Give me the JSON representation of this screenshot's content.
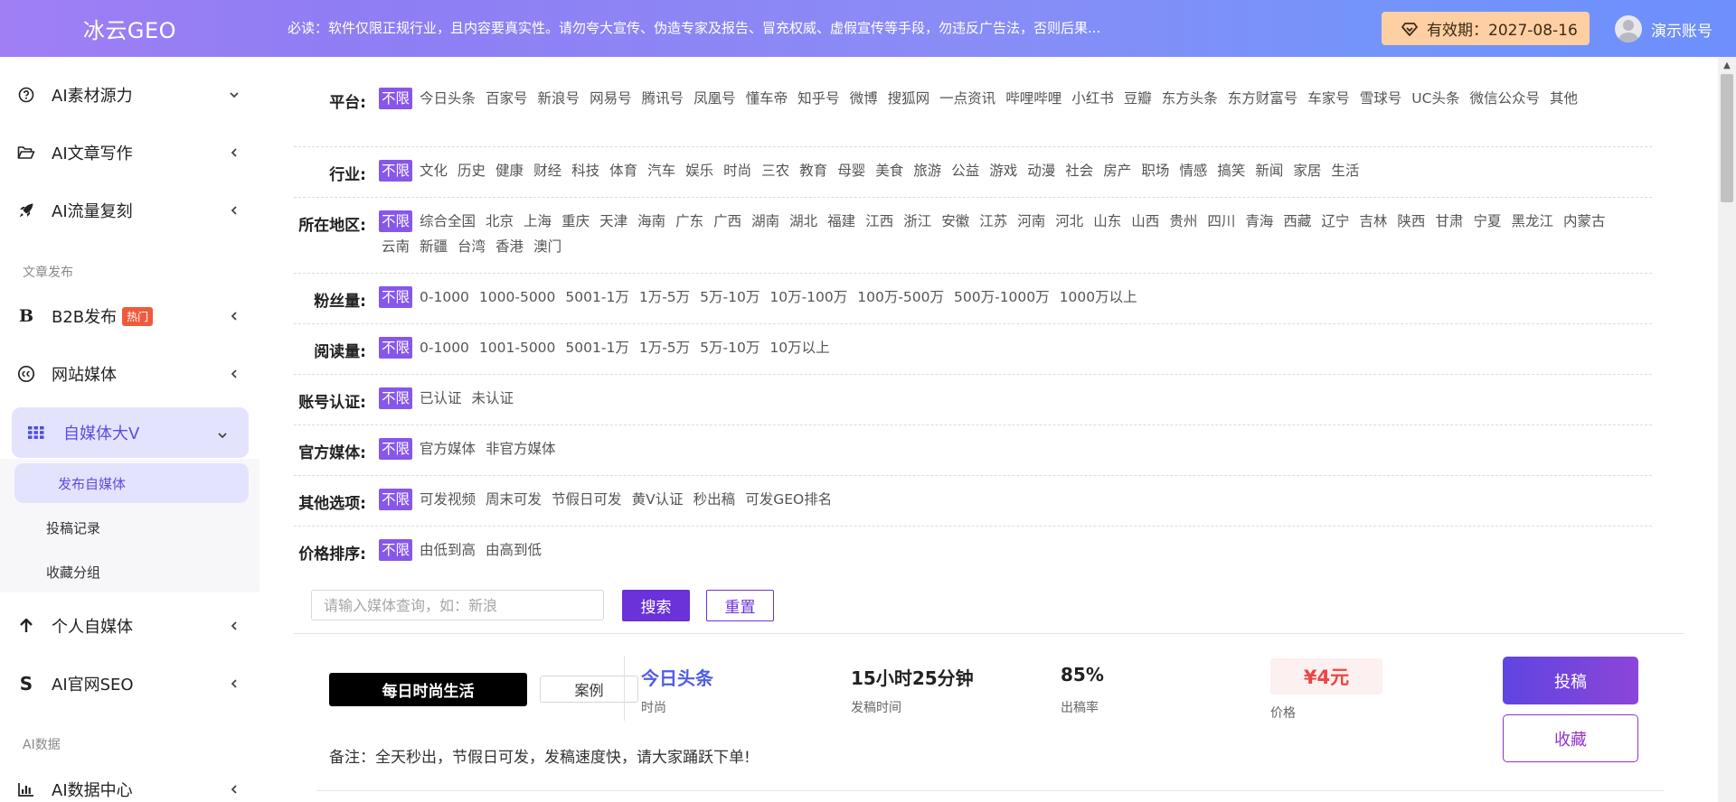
{
  "header": {
    "logo": "冰云GEO",
    "notice": "必读：软件仅限正规行业，且内容要真实性。请勿夸大宣传、伪造专家及报告、冒充权威、虚假宣传等手段，勿违反广告法，否则后果...",
    "expiry": "有效期：2027-08-16",
    "account": "演示账号"
  },
  "sidebar": {
    "items": [
      {
        "label": "AI素材源力",
        "icon": "question-circle-icon",
        "arrow": "chevron-down"
      },
      {
        "label": "AI文章写作",
        "icon": "folder-open-icon",
        "arrow": "chevron-left"
      },
      {
        "label": "AI流量复刻",
        "icon": "rocket-icon",
        "arrow": "chevron-left"
      }
    ],
    "section_publish": "文章发布",
    "b2b": {
      "label": "B2B发布",
      "badge": "热门",
      "icon": "b-letter-icon"
    },
    "website_media": {
      "label": "网站媒体",
      "icon": "cc-circle-icon"
    },
    "self_media": {
      "label": "自媒体大V",
      "icon": "grid-icon"
    },
    "sub_items": [
      "发布自媒体",
      "投稿记录",
      "收藏分组"
    ],
    "personal": {
      "label": "个人自媒体",
      "icon": "arrow-up-icon"
    },
    "seo": {
      "label": "AI官网SEO",
      "icon": "s-letter-icon"
    },
    "section_data": "AI数据",
    "data_center": {
      "label": "AI数据中心",
      "icon": "bar-chart-icon"
    }
  },
  "filters": [
    {
      "label": "平台:",
      "options": [
        "不限",
        "今日头条",
        "百家号",
        "新浪号",
        "网易号",
        "腾讯号",
        "凤凰号",
        "懂车帝",
        "知乎号",
        "微博",
        "搜狐网",
        "一点资讯",
        "哔哩哔哩",
        "小红书",
        "豆瓣",
        "东方头条",
        "东方财富号",
        "车家号",
        "雪球号",
        "UC头条",
        "微信公众号",
        "其他"
      ]
    },
    {
      "label": "行业:",
      "options": [
        "不限",
        "文化",
        "历史",
        "健康",
        "财经",
        "科技",
        "体育",
        "汽车",
        "娱乐",
        "时尚",
        "三农",
        "教育",
        "母婴",
        "美食",
        "旅游",
        "公益",
        "游戏",
        "动漫",
        "社会",
        "房产",
        "职场",
        "情感",
        "搞笑",
        "新闻",
        "家居",
        "生活"
      ]
    },
    {
      "label": "所在地区:",
      "options": [
        "不限",
        "综合全国",
        "北京",
        "上海",
        "重庆",
        "天津",
        "海南",
        "广东",
        "广西",
        "湖南",
        "湖北",
        "福建",
        "江西",
        "浙江",
        "安徽",
        "江苏",
        "河南",
        "河北",
        "山东",
        "山西",
        "贵州",
        "四川",
        "青海",
        "西藏",
        "辽宁",
        "吉林",
        "陕西",
        "甘肃",
        "宁夏",
        "黑龙江",
        "内蒙古",
        "云南",
        "新疆",
        "台湾",
        "香港",
        "澳门"
      ]
    },
    {
      "label": "粉丝量:",
      "options": [
        "不限",
        "0-1000",
        "1000-5000",
        "5001-1万",
        "1万-5万",
        "5万-10万",
        "10万-100万",
        "100万-500万",
        "500万-1000万",
        "1000万以上"
      ]
    },
    {
      "label": "阅读量:",
      "options": [
        "不限",
        "0-1000",
        "1001-5000",
        "5001-1万",
        "1万-5万",
        "5万-10万",
        "10万以上"
      ]
    },
    {
      "label": "账号认证:",
      "options": [
        "不限",
        "已认证",
        "未认证"
      ]
    },
    {
      "label": "官方媒体:",
      "options": [
        "不限",
        "官方媒体",
        "非官方媒体"
      ]
    },
    {
      "label": "其他选项:",
      "options": [
        "不限",
        "可发视频",
        "周末可发",
        "节假日可发",
        "黄V认证",
        "秒出稿",
        "可发GEO排名"
      ]
    },
    {
      "label": "价格排序:",
      "options": [
        "不限",
        "由低到高",
        "由高到低"
      ]
    }
  ],
  "search": {
    "placeholder": "请输入媒体查询，如：新浪",
    "search_label": "搜索",
    "reset_label": "重置"
  },
  "card": {
    "name": "每日时尚生活",
    "case_label": "案例",
    "platform": "今日头条",
    "category": "时尚",
    "publish_time": "15小时25分钟",
    "publish_time_label": "发稿时间",
    "rate": "85%",
    "rate_label": "出稿率",
    "price": "¥4元",
    "price_label": "价格",
    "submit_label": "投稿",
    "fav_label": "收藏",
    "remark": "备注：全天秒出，节假日可发，发稿速度快，请大家踊跃下单!"
  },
  "colors": {
    "accent": "#8757ea",
    "primary_button": "#6a32d8",
    "price": "#ec4545"
  }
}
